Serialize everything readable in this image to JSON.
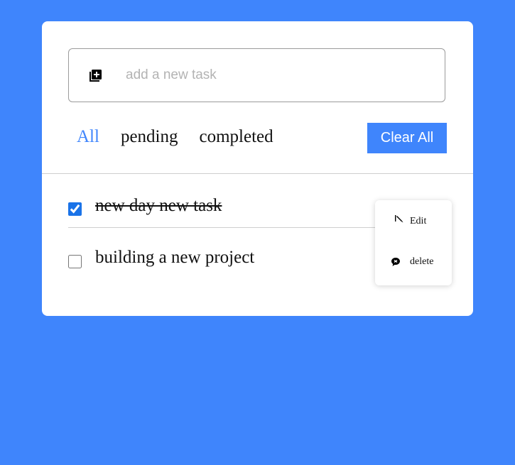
{
  "input": {
    "placeholder": "add a new task",
    "value": ""
  },
  "filters": [
    {
      "label": "All",
      "active": true
    },
    {
      "label": "pending",
      "active": false
    },
    {
      "label": "completed",
      "active": false
    }
  ],
  "clear_button": {
    "label": "Clear All"
  },
  "tasks": [
    {
      "label": "new day new task",
      "checked": true
    },
    {
      "label": "building a new project",
      "checked": false
    }
  ],
  "task_menu": {
    "edit_label": "Edit",
    "delete_label": "delete"
  },
  "colors": {
    "background": "#3f85fc",
    "accent": "#3f85fc",
    "card": "#ffffff"
  },
  "icons": {
    "add": "add-task-icon",
    "edit": "pencil-icon",
    "delete": "delete-icon"
  }
}
